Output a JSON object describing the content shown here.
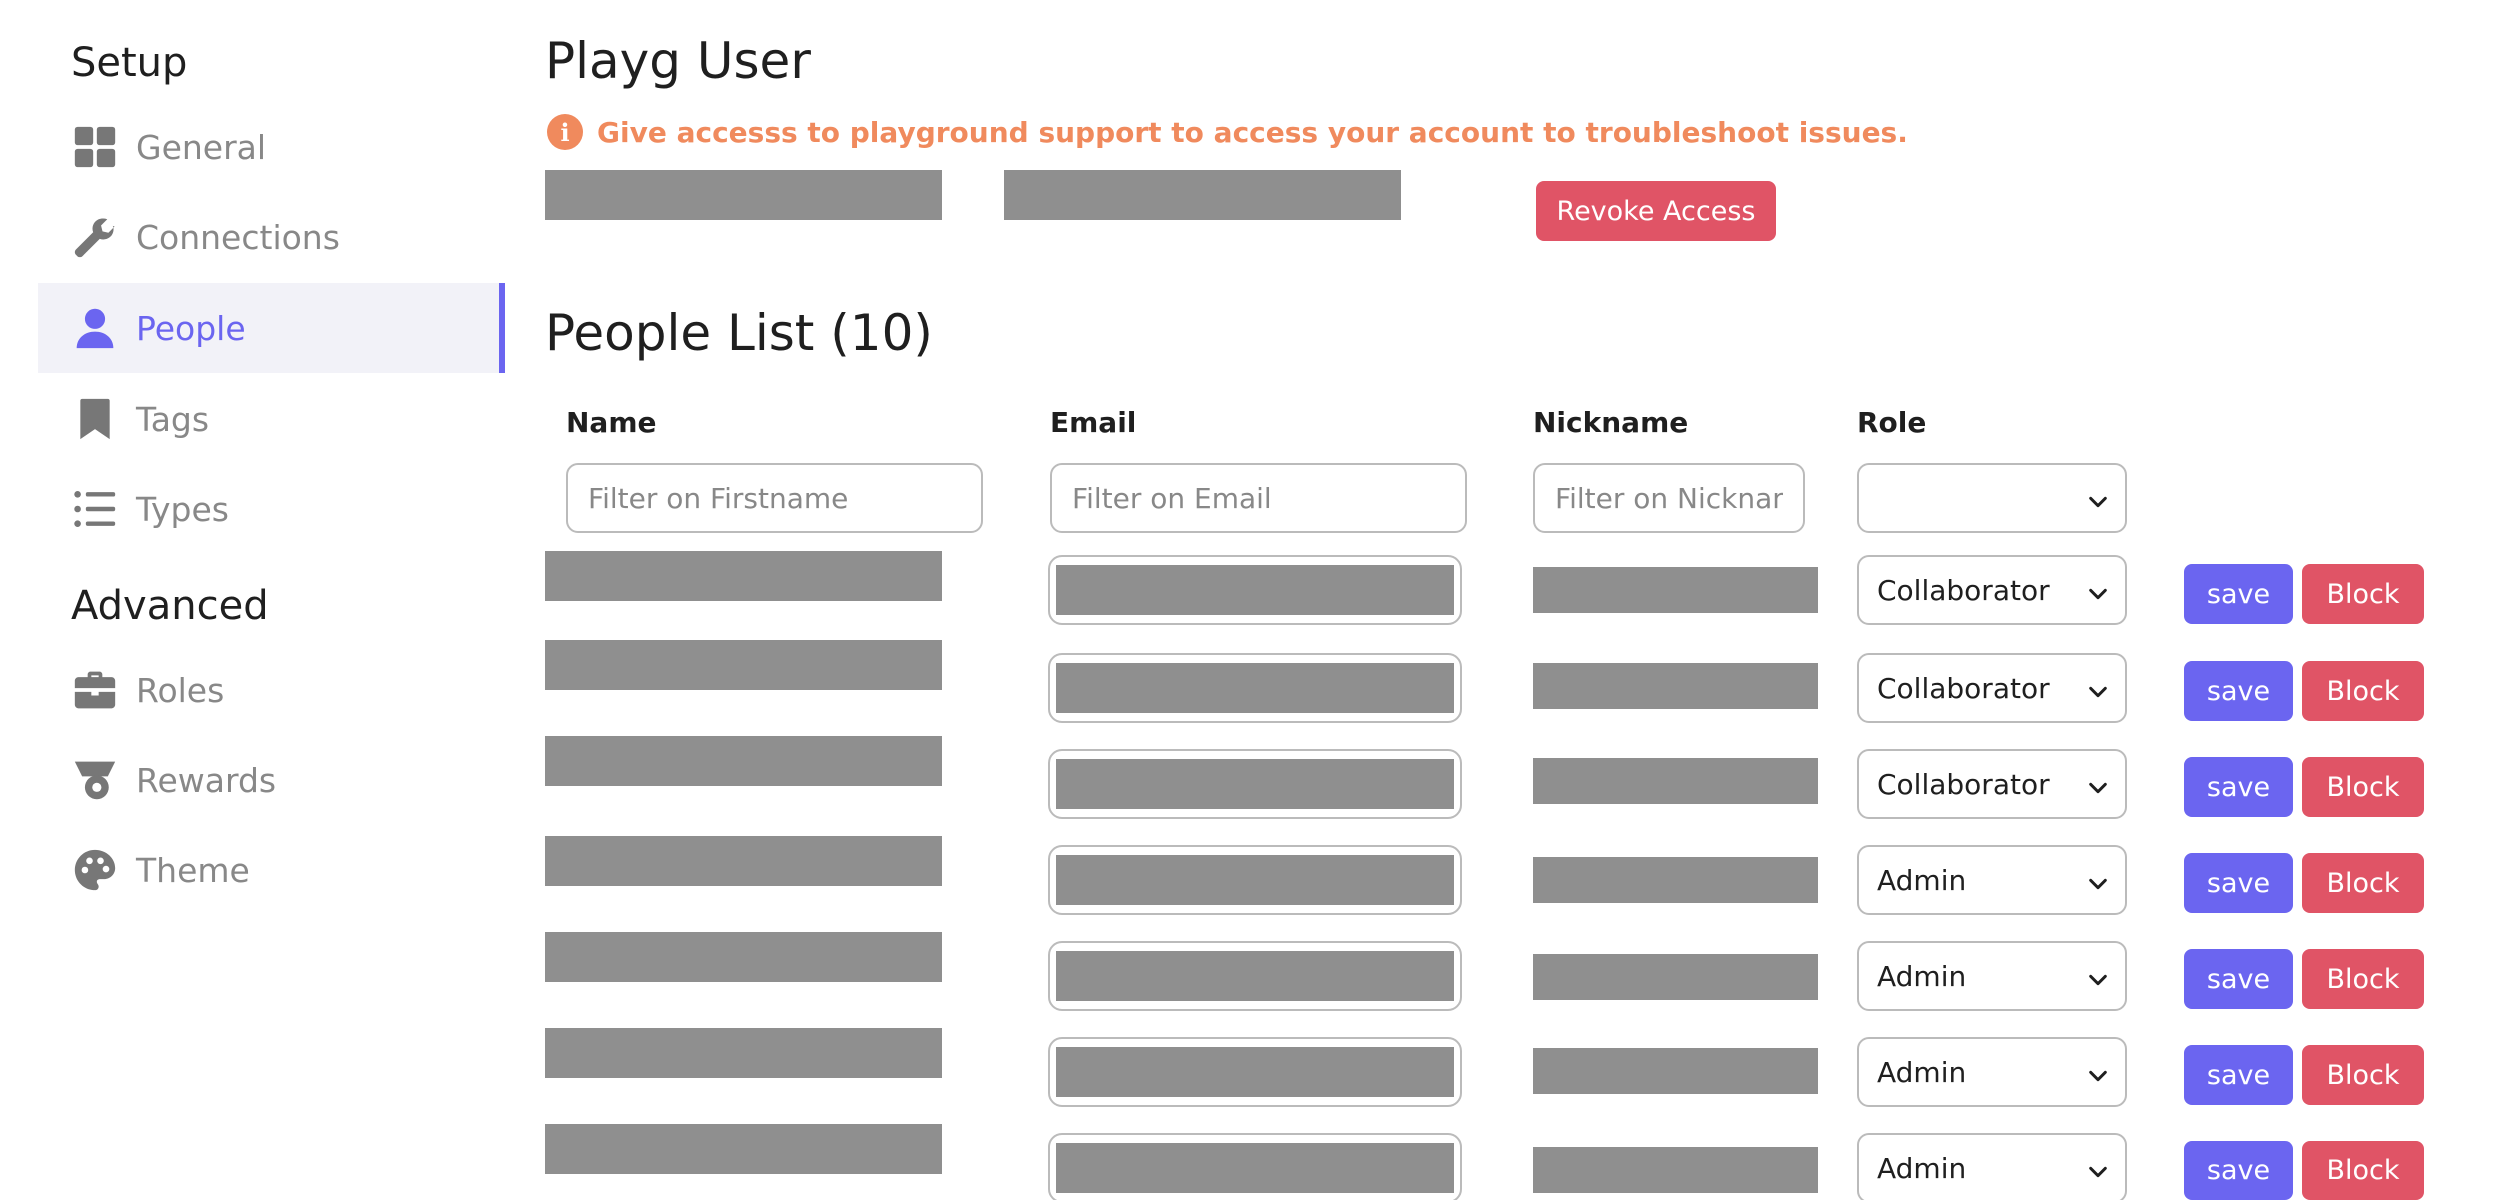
{
  "sidebar": {
    "sections": [
      {
        "title": "Setup",
        "items": [
          {
            "label": "General",
            "icon": "grid-icon",
            "active": false
          },
          {
            "label": "Connections",
            "icon": "wrench-icon",
            "active": false
          },
          {
            "label": "People",
            "icon": "person-icon",
            "active": true
          },
          {
            "label": "Tags",
            "icon": "bookmark-icon",
            "active": false
          },
          {
            "label": "Types",
            "icon": "list-icon",
            "active": false
          }
        ]
      },
      {
        "title": "Advanced",
        "items": [
          {
            "label": "Roles",
            "icon": "briefcase-icon",
            "active": false
          },
          {
            "label": "Rewards",
            "icon": "medal-icon",
            "active": false
          },
          {
            "label": "Theme",
            "icon": "palette-icon",
            "active": false
          }
        ]
      }
    ]
  },
  "playg": {
    "title": "Playg User",
    "info": "Give accesss to playground support to access your account to troubleshoot issues.",
    "revoke_label": "Revoke Access"
  },
  "people": {
    "title": "People List (10)",
    "columns": [
      "Name",
      "Email",
      "Nickname",
      "Role"
    ],
    "filters": {
      "name_placeholder": "Filter on Firstname",
      "email_placeholder": "Filter on Email",
      "nickname_placeholder": "Filter on Nickname",
      "role_value": ""
    },
    "rows": [
      {
        "role": "Collaborator"
      },
      {
        "role": "Collaborator"
      },
      {
        "role": "Collaborator"
      },
      {
        "role": "Admin"
      },
      {
        "role": "Admin"
      },
      {
        "role": "Admin"
      },
      {
        "role": "Admin"
      }
    ],
    "save_label": "save",
    "block_label": "Block"
  },
  "colors": {
    "accent": "#6b65f0",
    "danger": "#e05466",
    "warning": "#f08a5d",
    "redacted": "#8f8f8f"
  }
}
